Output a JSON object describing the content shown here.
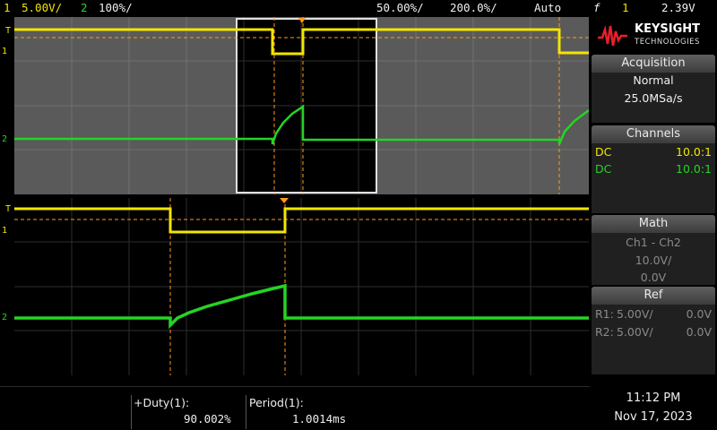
{
  "topbar": {
    "ch1_num": "1",
    "ch1_scale": "5.00V/",
    "ch2_num": "2",
    "ch2_scale": "100%/",
    "time_pos": "50.00%/",
    "time_scale": "200.0%/",
    "trigger_mode": "Auto",
    "trigger_symbol": "f",
    "trigger_source": "1",
    "trigger_level": "2.39V"
  },
  "markers": {
    "trigger_T": "T",
    "ch1": "1",
    "ch2": "2"
  },
  "logo": {
    "brand": "KEYSIGHT",
    "sub": "TECHNOLOGIES"
  },
  "acquisition": {
    "header": "Acquisition",
    "mode": "Normal",
    "rate": "25.0MSa/s"
  },
  "channels": {
    "header": "Channels",
    "rows": [
      {
        "coupling": "DC",
        "probe": "10.0:1",
        "color": "#f2e600"
      },
      {
        "coupling": "DC",
        "probe": "10.0:1",
        "color": "#25d425"
      }
    ]
  },
  "math": {
    "header": "Math",
    "expr": "Ch1 - Ch2",
    "scale": "10.0V/",
    "offset": "0.0V"
  },
  "ref": {
    "header": "Ref",
    "rows": [
      {
        "name": "R1:",
        "scale": "5.00V/",
        "offset": "0.0V"
      },
      {
        "name": "R2:",
        "scale": "5.00V/",
        "offset": "0.0V"
      }
    ]
  },
  "measurements": [
    {
      "label": "+Duty(1):",
      "value": "90.002%"
    },
    {
      "label": "Period(1):",
      "value": "1.0014ms"
    }
  ],
  "clock": {
    "time": "11:12 PM",
    "date": "Nov 17, 2023"
  },
  "colors": {
    "ch1": "#f2e600",
    "ch2": "#25d425",
    "cursor": "#ff9a1a",
    "grid_bg": "#595959"
  }
}
